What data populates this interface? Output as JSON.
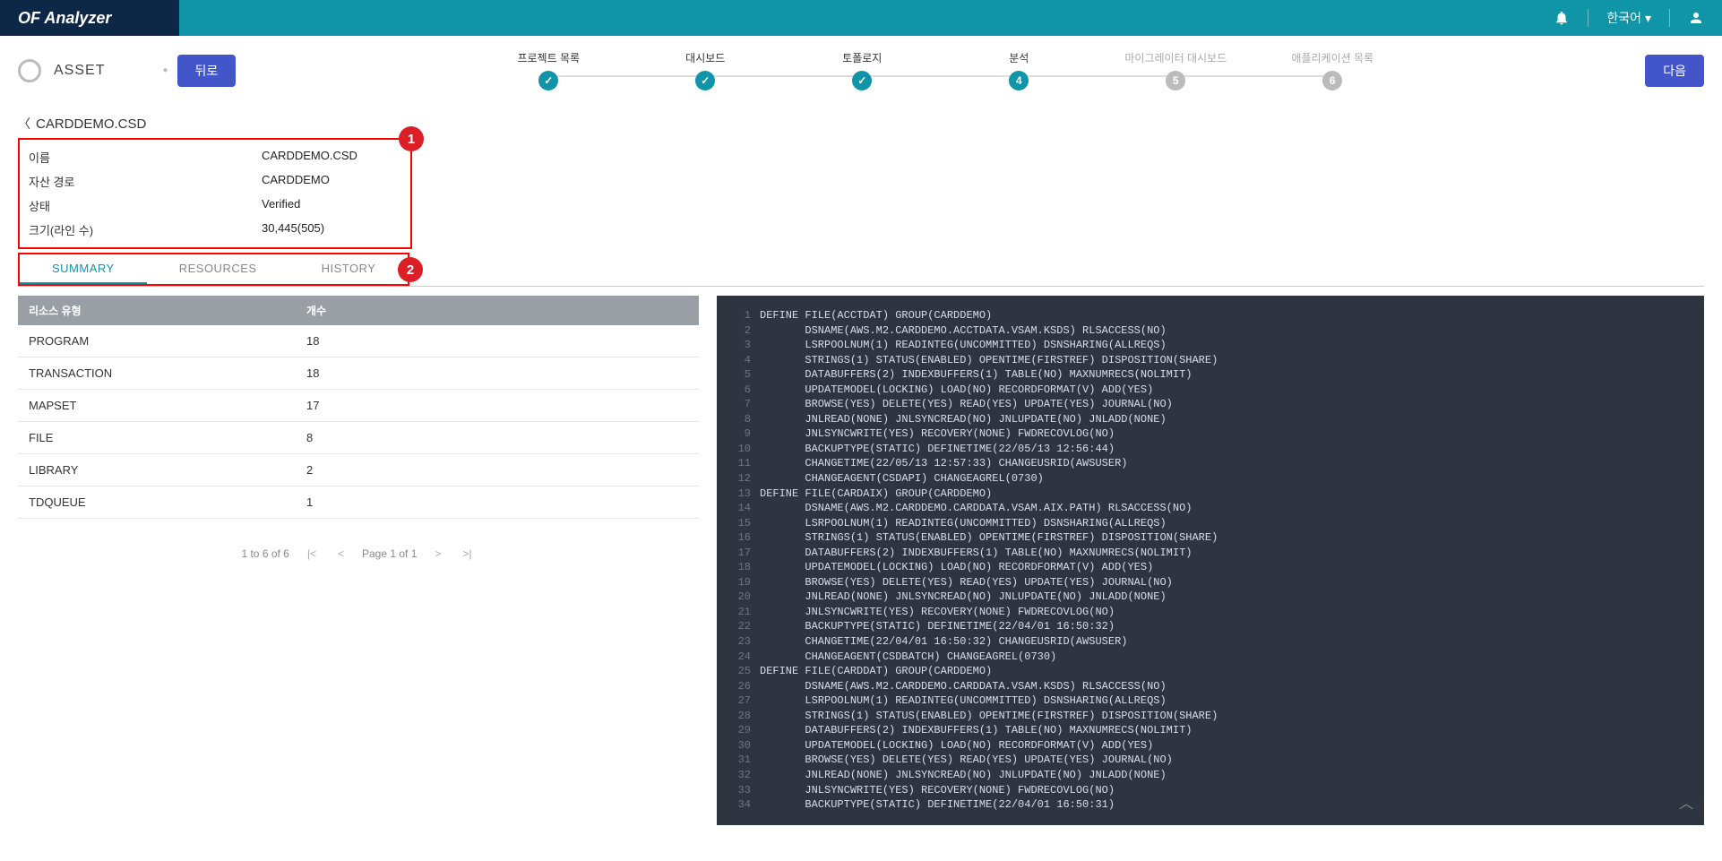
{
  "header": {
    "logo": "OF Analyzer",
    "language": "한국어"
  },
  "wizard": {
    "asset_label": "ASSET",
    "back_btn": "뒤로",
    "next_btn": "다음",
    "steps": [
      {
        "label": "프로젝트 목록",
        "state": "done"
      },
      {
        "label": "대시보드",
        "state": "done"
      },
      {
        "label": "토폴로지",
        "state": "done"
      },
      {
        "label": "분석",
        "state": "current",
        "num": "4"
      },
      {
        "label": "마이그레이터 대시보드",
        "state": "pending",
        "num": "5"
      },
      {
        "label": "애플리케이션 목록",
        "state": "pending",
        "num": "6"
      }
    ]
  },
  "breadcrumb": {
    "title": "CARDDEMO.CSD"
  },
  "info": {
    "rows": [
      {
        "label": "이름",
        "value": "CARDDEMO.CSD"
      },
      {
        "label": "자산 경로",
        "value": "CARDDEMO"
      },
      {
        "label": "상태",
        "value": "Verified"
      },
      {
        "label": "크기(라인 수)",
        "value": "30,445(505)"
      }
    ]
  },
  "annotations": {
    "a1": "1",
    "a2": "2"
  },
  "tabs": [
    {
      "label": "SUMMARY",
      "active": true
    },
    {
      "label": "RESOURCES",
      "active": false
    },
    {
      "label": "HISTORY",
      "active": false
    }
  ],
  "table": {
    "headers": [
      "리소스 유형",
      "개수"
    ],
    "rows": [
      {
        "type": "PROGRAM",
        "count": "18"
      },
      {
        "type": "TRANSACTION",
        "count": "18"
      },
      {
        "type": "MAPSET",
        "count": "17"
      },
      {
        "type": "FILE",
        "count": "8"
      },
      {
        "type": "LIBRARY",
        "count": "2"
      },
      {
        "type": "TDQUEUE",
        "count": "1"
      }
    ]
  },
  "pager": {
    "range": "1 to 6 of 6",
    "page": "Page 1 of 1"
  },
  "code": [
    "DEFINE FILE(ACCTDAT) GROUP(CARDDEMO)",
    "       DSNAME(AWS.M2.CARDDEMO.ACCTDATA.VSAM.KSDS) RLSACCESS(NO)",
    "       LSRPOOLNUM(1) READINTEG(UNCOMMITTED) DSNSHARING(ALLREQS)",
    "       STRINGS(1) STATUS(ENABLED) OPENTIME(FIRSTREF) DISPOSITION(SHARE)",
    "       DATABUFFERS(2) INDEXBUFFERS(1) TABLE(NO) MAXNUMRECS(NOLIMIT)",
    "       UPDATEMODEL(LOCKING) LOAD(NO) RECORDFORMAT(V) ADD(YES)",
    "       BROWSE(YES) DELETE(YES) READ(YES) UPDATE(YES) JOURNAL(NO)",
    "       JNLREAD(NONE) JNLSYNCREAD(NO) JNLUPDATE(NO) JNLADD(NONE)",
    "       JNLSYNCWRITE(YES) RECOVERY(NONE) FWDRECOVLOG(NO)",
    "       BACKUPTYPE(STATIC) DEFINETIME(22/05/13 12:56:44)",
    "       CHANGETIME(22/05/13 12:57:33) CHANGEUSRID(AWSUSER)",
    "       CHANGEAGENT(CSDAPI) CHANGEAGREL(0730)",
    "DEFINE FILE(CARDAIX) GROUP(CARDDEMO)",
    "       DSNAME(AWS.M2.CARDDEMO.CARDDATA.VSAM.AIX.PATH) RLSACCESS(NO)",
    "       LSRPOOLNUM(1) READINTEG(UNCOMMITTED) DSNSHARING(ALLREQS)",
    "       STRINGS(1) STATUS(ENABLED) OPENTIME(FIRSTREF) DISPOSITION(SHARE)",
    "       DATABUFFERS(2) INDEXBUFFERS(1) TABLE(NO) MAXNUMRECS(NOLIMIT)",
    "       UPDATEMODEL(LOCKING) LOAD(NO) RECORDFORMAT(V) ADD(YES)",
    "       BROWSE(YES) DELETE(YES) READ(YES) UPDATE(YES) JOURNAL(NO)",
    "       JNLREAD(NONE) JNLSYNCREAD(NO) JNLUPDATE(NO) JNLADD(NONE)",
    "       JNLSYNCWRITE(YES) RECOVERY(NONE) FWDRECOVLOG(NO)",
    "       BACKUPTYPE(STATIC) DEFINETIME(22/04/01 16:50:32)",
    "       CHANGETIME(22/04/01 16:50:32) CHANGEUSRID(AWSUSER)",
    "       CHANGEAGENT(CSDBATCH) CHANGEAGREL(0730)",
    "DEFINE FILE(CARDDAT) GROUP(CARDDEMO)",
    "       DSNAME(AWS.M2.CARDDEMO.CARDDATA.VSAM.KSDS) RLSACCESS(NO)",
    "       LSRPOOLNUM(1) READINTEG(UNCOMMITTED) DSNSHARING(ALLREQS)",
    "       STRINGS(1) STATUS(ENABLED) OPENTIME(FIRSTREF) DISPOSITION(SHARE)",
    "       DATABUFFERS(2) INDEXBUFFERS(1) TABLE(NO) MAXNUMRECS(NOLIMIT)",
    "       UPDATEMODEL(LOCKING) LOAD(NO) RECORDFORMAT(V) ADD(YES)",
    "       BROWSE(YES) DELETE(YES) READ(YES) UPDATE(YES) JOURNAL(NO)",
    "       JNLREAD(NONE) JNLSYNCREAD(NO) JNLUPDATE(NO) JNLADD(NONE)",
    "       JNLSYNCWRITE(YES) RECOVERY(NONE) FWDRECOVLOG(NO)",
    "       BACKUPTYPE(STATIC) DEFINETIME(22/04/01 16:50:31)"
  ]
}
